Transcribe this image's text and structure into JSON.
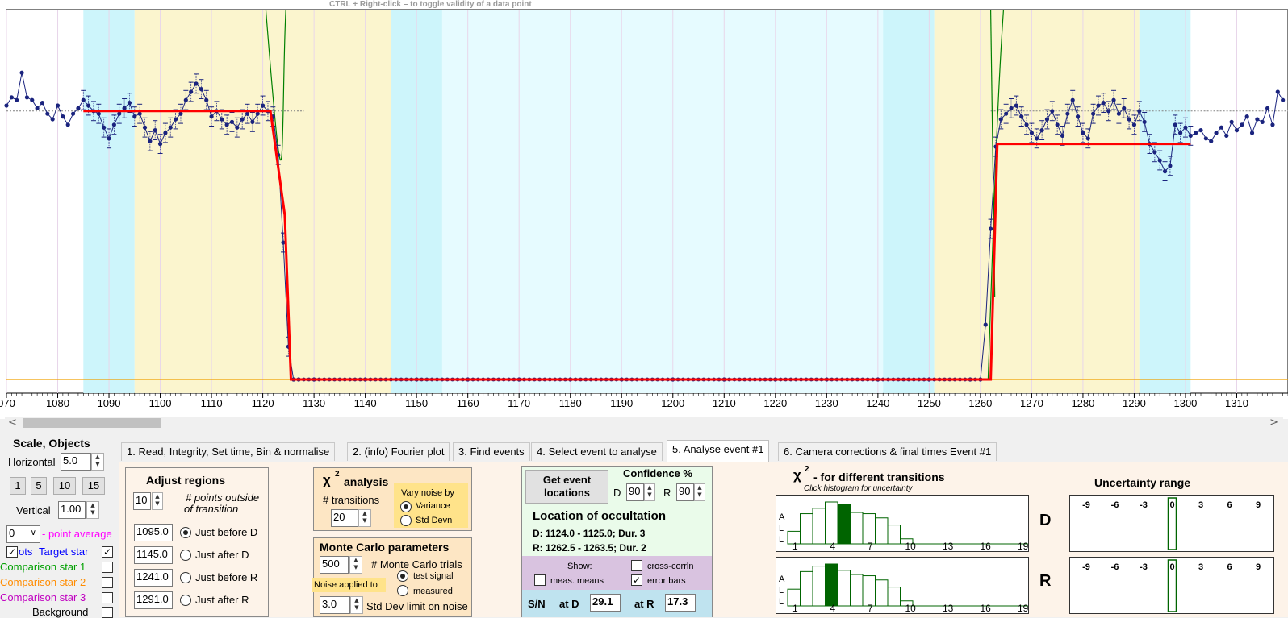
{
  "hint": "CTRL + Right-click  –  to toggle validity of a data point",
  "chart_data": {
    "type": "line",
    "title": "",
    "xlabel": "",
    "ylabel": "",
    "xlim": [
      1070,
      1320
    ],
    "ylim": [
      -0.05,
      1.35
    ],
    "x_ticks": [
      1070,
      1080,
      1090,
      1100,
      1110,
      1120,
      1130,
      1140,
      1150,
      1160,
      1170,
      1180,
      1190,
      1200,
      1210,
      1220,
      1230,
      1240,
      1250,
      1260,
      1270,
      1280,
      1290,
      1300,
      1310
    ],
    "x_tick_labels": [
      "070",
      "1080",
      "1090",
      "1100",
      "1110",
      "1120",
      "1130",
      "1140",
      "1150",
      "1160",
      "1170",
      "1180",
      "1190",
      "1200",
      "1210",
      "1220",
      "1230",
      "1240",
      "1250",
      "1260",
      "1270",
      "1280",
      "1290",
      "1300",
      "1310"
    ],
    "regions": [
      {
        "from": 1085,
        "to": 1095,
        "color": "#cdf5fb"
      },
      {
        "from": 1095,
        "to": 1145,
        "color": "#fbf5ce"
      },
      {
        "from": 1145,
        "to": 1155,
        "color": "#cdf5fb"
      },
      {
        "from": 1155,
        "to": 1241,
        "color": "#e6fbff"
      },
      {
        "from": 1241,
        "to": 1251,
        "color": "#cdf5fb"
      },
      {
        "from": 1251,
        "to": 1291,
        "color": "#fbf5ce"
      },
      {
        "from": 1291,
        "to": 1301,
        "color": "#cdf5fb"
      }
    ],
    "series": [
      {
        "name": "Target star",
        "color": "#1a237e",
        "x": [
          1070,
          1071,
          1072,
          1073,
          1074,
          1075,
          1076,
          1077,
          1078,
          1079,
          1080,
          1081,
          1082,
          1083,
          1084,
          1085,
          1086,
          1087,
          1088,
          1089,
          1090,
          1091,
          1092,
          1093,
          1094,
          1095,
          1096,
          1097,
          1098,
          1099,
          1100,
          1101,
          1102,
          1103,
          1104,
          1105,
          1106,
          1107,
          1108,
          1109,
          1110,
          1111,
          1112,
          1113,
          1114,
          1115,
          1116,
          1117,
          1118,
          1119,
          1120,
          1121,
          1122,
          1123,
          1124,
          1125,
          1126,
          1127,
          1130,
          1140,
          1150,
          1160,
          1170,
          1180,
          1190,
          1200,
          1210,
          1220,
          1230,
          1240,
          1250,
          1258,
          1260,
          1261,
          1262,
          1263,
          1264,
          1265,
          1266,
          1267,
          1268,
          1269,
          1270,
          1271,
          1272,
          1273,
          1274,
          1275,
          1276,
          1277,
          1278,
          1279,
          1280,
          1281,
          1282,
          1283,
          1284,
          1285,
          1286,
          1287,
          1288,
          1289,
          1290,
          1291,
          1292,
          1293,
          1294,
          1295,
          1296,
          1297,
          1298,
          1299,
          1300,
          1301,
          1302,
          1303,
          1304,
          1305,
          1306,
          1307,
          1308,
          1309,
          1310,
          1311,
          1312,
          1313,
          1314,
          1315,
          1316,
          1317,
          1318,
          1319
        ],
        "y": [
          1.0,
          1.03,
          1.02,
          1.12,
          1.03,
          1.02,
          0.99,
          1.01,
          0.97,
          0.95,
          1.0,
          0.96,
          0.93,
          0.97,
          0.99,
          1.02,
          1.0,
          0.98,
          0.97,
          0.92,
          0.88,
          0.93,
          0.97,
          0.99,
          1.01,
          0.96,
          0.97,
          0.92,
          0.87,
          0.91,
          0.86,
          0.9,
          0.92,
          0.95,
          0.97,
          1.02,
          1.05,
          1.08,
          1.06,
          1.02,
          0.96,
          0.98,
          0.95,
          0.93,
          0.94,
          0.92,
          0.95,
          0.97,
          0.94,
          0.97,
          1.0,
          0.98,
          0.96,
          0.82,
          0.5,
          0.12,
          0.0,
          0.0,
          0.0,
          0.0,
          0.0,
          0.0,
          0.0,
          0.0,
          0.0,
          0.0,
          0.0,
          0.0,
          0.0,
          0.0,
          0.0,
          0.0,
          0.0,
          0.2,
          0.55,
          0.85,
          0.95,
          0.97,
          0.99,
          1.0,
          0.96,
          0.93,
          0.9,
          0.88,
          0.91,
          0.95,
          0.98,
          0.93,
          0.89,
          0.97,
          1.02,
          0.96,
          0.9,
          0.88,
          0.97,
          1.0,
          1.01,
          0.98,
          1.02,
          0.97,
          0.99,
          0.95,
          0.93,
          0.98,
          0.94,
          0.86,
          0.83,
          0.8,
          0.76,
          0.78,
          0.93,
          0.9,
          0.92,
          0.89,
          0.9,
          0.91,
          0.88,
          0.87,
          0.9,
          0.92,
          0.89,
          0.94,
          0.91,
          0.93,
          0.96,
          0.9,
          0.95,
          0.94,
          0.99,
          0.93,
          1.05,
          1.02
        ]
      },
      {
        "name": "Model fit",
        "color": "#ff0000",
        "x": [
          1085,
          1121.5,
          1124.3,
          1125.5,
          1262.0,
          1263.3,
          1301
        ],
        "y": [
          0.98,
          0.98,
          0.6,
          0.0,
          0.0,
          0.86,
          0.86
        ]
      }
    ],
    "baseline": {
      "y": 0.0,
      "color": "#f0a000"
    },
    "full_level": {
      "y": 0.98,
      "color": "#808080"
    }
  },
  "scrollbar": {
    "left": "<",
    "right": ">"
  },
  "left": {
    "title": "Scale,  Objects",
    "horizontal_label": "Horizontal",
    "horizontal_value": "5.0",
    "scale_buttons": [
      "1",
      "5",
      "10",
      "15"
    ],
    "vertical_label": "Vertical",
    "vertical_value": "1.00",
    "point_avg_value": "0",
    "point_avg_label": "- point average",
    "pts_label": "ots",
    "target_label": "Target star",
    "comp1": "Comparison star 1",
    "comp2": "Comparison star 2",
    "comp3": "Comparison star 3",
    "background": "Background",
    "colors": {
      "target": "#0000ff",
      "comp1": "#00a000",
      "comp2": "#ff8c00",
      "comp3": "#c000c0"
    }
  },
  "tabs": [
    "1.  Read, Integrity, Set time, Bin & normalise",
    "2. (info)  Fourier plot",
    "3. Find events",
    "4. Select event to analyse",
    "5. Analyse event #1",
    "6. Camera corrections & final times Event #1"
  ],
  "adjust": {
    "title": "Adjust regions",
    "points_value": "10",
    "points_label_1": "# points outside",
    "points_label_2": "of transition",
    "rows": [
      {
        "value": "1095.0",
        "label": "Just before D"
      },
      {
        "value": "1145.0",
        "label": "Just after D"
      },
      {
        "value": "1241.0",
        "label": "Just before R"
      },
      {
        "value": "1291.0",
        "label": "Just after R"
      }
    ]
  },
  "chi": {
    "title": "analysis",
    "chi_symbol": "χ",
    "sup": "2",
    "transitions_label": "# transitions",
    "transitions_value": "20",
    "vary_label": "Vary noise by",
    "variance": "Variance",
    "stddevn": "Std Devn"
  },
  "mc": {
    "title": "Monte Carlo parameters",
    "trials_value": "500",
    "trials_label": "# Monte Carlo trials",
    "noise_label": "Noise applied to",
    "test_signal": "test signal",
    "measured": "measured",
    "std_value": "3.0",
    "std_label": "Std Dev limit on noise"
  },
  "location": {
    "get_btn_1": "Get event",
    "get_btn_2": "locations",
    "confidence": "Confidence %",
    "d_label": "D",
    "d_value": "90",
    "r_label": "R",
    "r_value": "90",
    "title": "Location of occultation",
    "d_line": "D: 1124.0 - 1125.0; Dur. 3",
    "r_line": "R: 1262.5 - 1263.5; Dur. 2",
    "show": "Show:",
    "meas_means": "meas. means",
    "cross_corrln": "cross-corrln",
    "error_bars": "error bars",
    "sn": "S/N",
    "at_d": "at D",
    "sn_d": "29.1",
    "at_r": "at R",
    "sn_r": "17.3"
  },
  "hist": {
    "title": "- for different transitions",
    "chi_symbol": "χ",
    "sup": "2",
    "subtitle": "Click histogram for uncertainty",
    "all_label": [
      "A",
      "L",
      "L"
    ],
    "x_labels": [
      "1",
      "4",
      "7",
      "10",
      "13",
      "16",
      "19"
    ],
    "d_label": "D",
    "r_label": "R",
    "d_bars": [
      0.3,
      0.72,
      0.85,
      1.0,
      0.95,
      0.75,
      0.72,
      0.62,
      0.45,
      0.12,
      0.0,
      0.0,
      0.0,
      0.0,
      0.0,
      0.0,
      0.0,
      0.0,
      0.0,
      0.0
    ],
    "d_selected": 4,
    "r_bars": [
      0.4,
      0.82,
      0.95,
      1.0,
      0.85,
      0.75,
      0.72,
      0.62,
      0.45,
      0.12,
      0.0,
      0.0,
      0.0,
      0.0,
      0.0,
      0.0,
      0.0,
      0.0,
      0.0,
      0.0
    ],
    "r_selected": 3
  },
  "uncert": {
    "title": "Uncertainty range",
    "ticks": [
      "-9",
      "-6",
      "-3",
      "0",
      "3",
      "6",
      "9"
    ]
  }
}
